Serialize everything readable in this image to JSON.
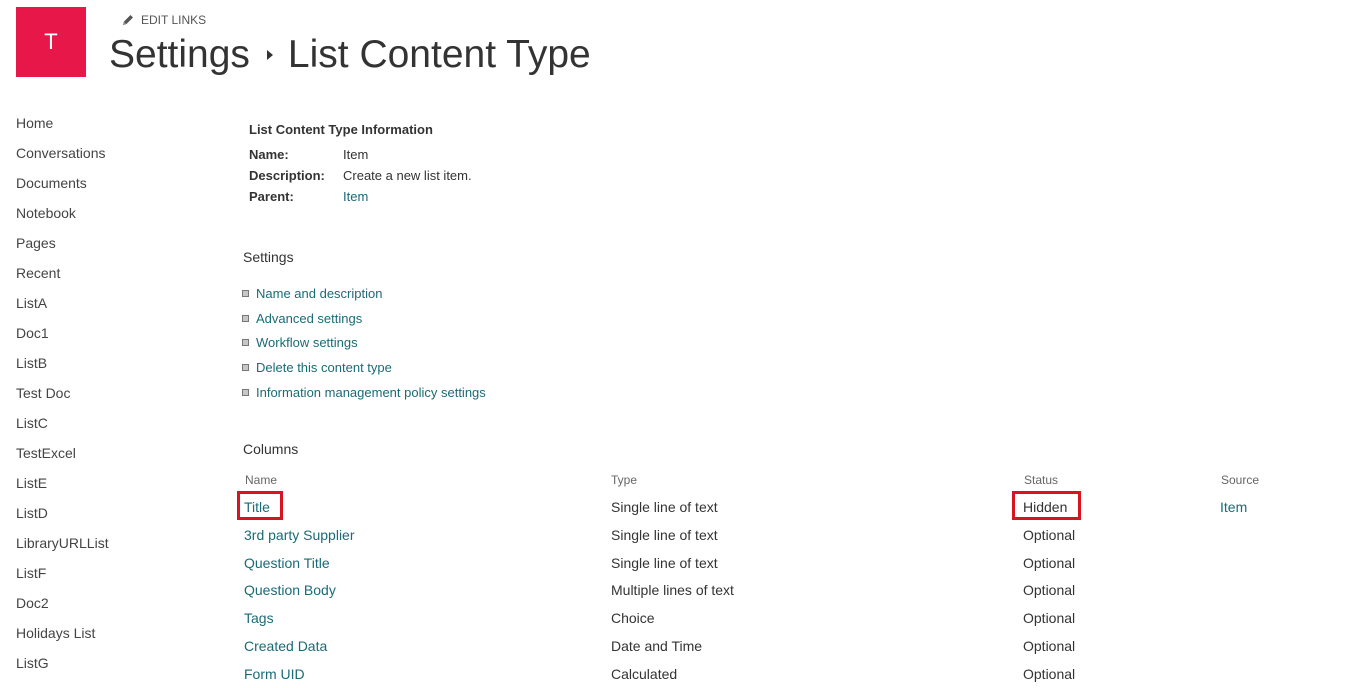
{
  "header": {
    "logo_letter": "T",
    "logo_color": "#e8174a",
    "edit_links_label": "EDIT LINKS",
    "edit_icon": "pencil-icon",
    "breadcrumb": [
      "Settings",
      "List Content Type"
    ],
    "breadcrumb_separator_icon": "caret-right-icon"
  },
  "quick_launch": [
    "Home",
    "Conversations",
    "Documents",
    "Notebook",
    "Pages",
    "Recent",
    "ListA",
    "Doc1",
    "ListB",
    "Test Doc",
    "ListC",
    "TestExcel",
    "ListE",
    "ListD",
    "LibraryURLList",
    "ListF",
    "Doc2",
    "Holidays List",
    "ListG"
  ],
  "info": {
    "title": "List Content Type Information",
    "name_label": "Name:",
    "name_value": "Item",
    "description_label": "Description:",
    "description_value": "Create a new list item.",
    "parent_label": "Parent:",
    "parent_value": "Item"
  },
  "settings": {
    "heading": "Settings",
    "links": [
      "Name and description",
      "Advanced settings",
      "Workflow settings",
      "Delete this content type",
      "Information management policy settings"
    ]
  },
  "columns": {
    "heading": "Columns",
    "headers": {
      "name": "Name",
      "type": "Type",
      "status": "Status",
      "source": "Source"
    },
    "rows": [
      {
        "name": "Title",
        "type": "Single line of text",
        "status": "Hidden",
        "source": "Item"
      },
      {
        "name": "3rd party Supplier",
        "type": "Single line of text",
        "status": "Optional",
        "source": ""
      },
      {
        "name": "Question Title",
        "type": "Single line of text",
        "status": "Optional",
        "source": ""
      },
      {
        "name": "Question Body",
        "type": "Multiple lines of text",
        "status": "Optional",
        "source": ""
      },
      {
        "name": "Tags",
        "type": "Choice",
        "status": "Optional",
        "source": ""
      },
      {
        "name": "Created Data",
        "type": "Date and Time",
        "status": "Optional",
        "source": ""
      },
      {
        "name": "Form UID",
        "type": "Calculated",
        "status": "Optional",
        "source": ""
      }
    ]
  },
  "colors": {
    "link": "#1a6b77",
    "highlight_box": "#d9131f"
  }
}
